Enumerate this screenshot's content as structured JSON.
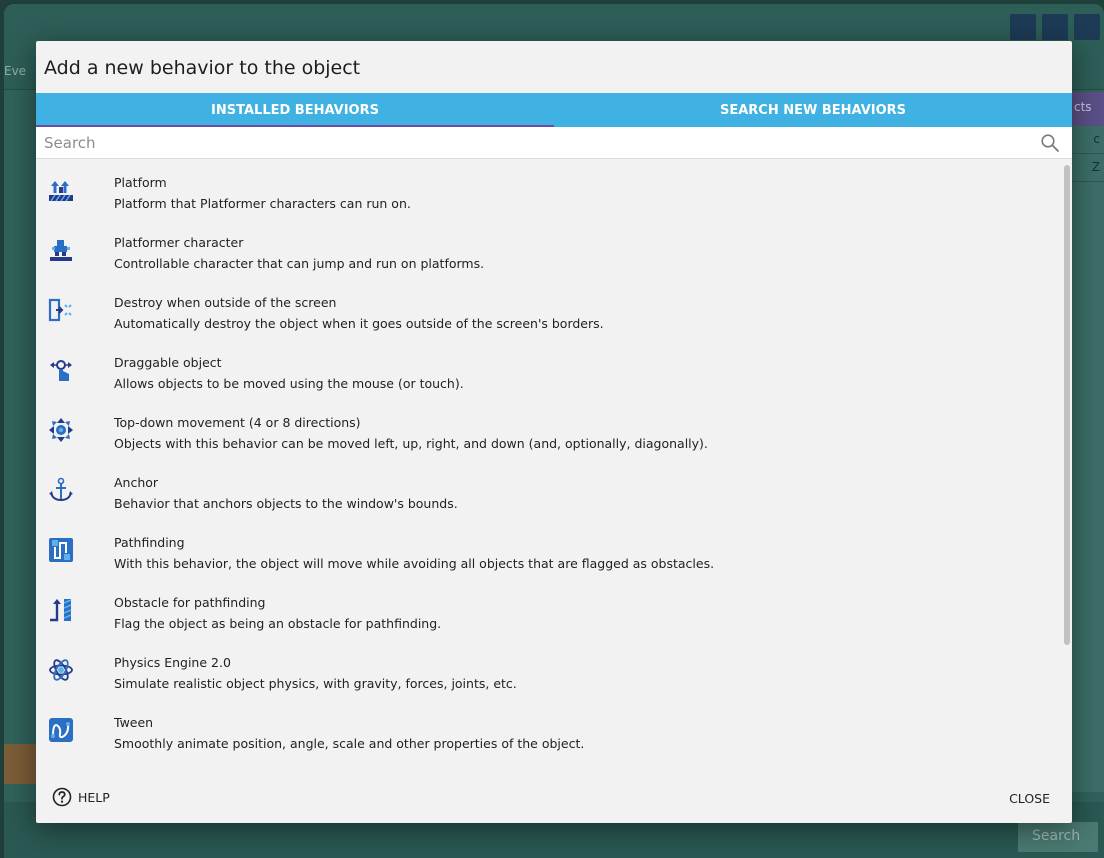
{
  "background": {
    "tab_fragment": "Eve",
    "panel_header": "cts",
    "panel_rows": [
      "c",
      "Z"
    ],
    "search_label": "Search"
  },
  "dialog": {
    "title": "Add a new behavior to the object",
    "tabs": [
      {
        "label": "INSTALLED BEHAVIORS",
        "active": true
      },
      {
        "label": "SEARCH NEW BEHAVIORS",
        "active": false
      }
    ],
    "search": {
      "placeholder": "Search",
      "value": ""
    },
    "behaviors": [
      {
        "name": "Platform",
        "description": "Platform that Platformer characters can run on.",
        "icon": "platform-icon"
      },
      {
        "name": "Platformer character",
        "description": "Controllable character that can jump and run on platforms.",
        "icon": "platformer-character-icon"
      },
      {
        "name": "Destroy when outside of the screen",
        "description": "Automatically destroy the object when it goes outside of the screen's borders.",
        "icon": "destroy-outside-icon"
      },
      {
        "name": "Draggable object",
        "description": "Allows objects to be moved using the mouse (or touch).",
        "icon": "draggable-icon"
      },
      {
        "name": "Top-down movement (4 or 8 directions)",
        "description": "Objects with this behavior can be moved left, up, right, and down (and, optionally, diagonally).",
        "icon": "topdown-movement-icon"
      },
      {
        "name": "Anchor",
        "description": "Behavior that anchors objects to the window's bounds.",
        "icon": "anchor-icon"
      },
      {
        "name": "Pathfinding",
        "description": "With this behavior, the object will move while avoiding all objects that are flagged as obstacles.",
        "icon": "pathfinding-icon"
      },
      {
        "name": "Obstacle for pathfinding",
        "description": "Flag the object as being an obstacle for pathfinding.",
        "icon": "obstacle-icon"
      },
      {
        "name": "Physics Engine 2.0",
        "description": "Simulate realistic object physics, with gravity, forces, joints, etc.",
        "icon": "physics-icon"
      },
      {
        "name": "Tween",
        "description": "Smoothly animate position, angle, scale and other properties of the object.",
        "icon": "tween-icon"
      }
    ],
    "help_label": "HELP",
    "close_label": "CLOSE"
  },
  "colors": {
    "tab_bar": "#3fb2e3",
    "tab_indicator": "#6a4ca3",
    "icon_blue": "#2a6fc4",
    "icon_dark": "#243a8c"
  }
}
